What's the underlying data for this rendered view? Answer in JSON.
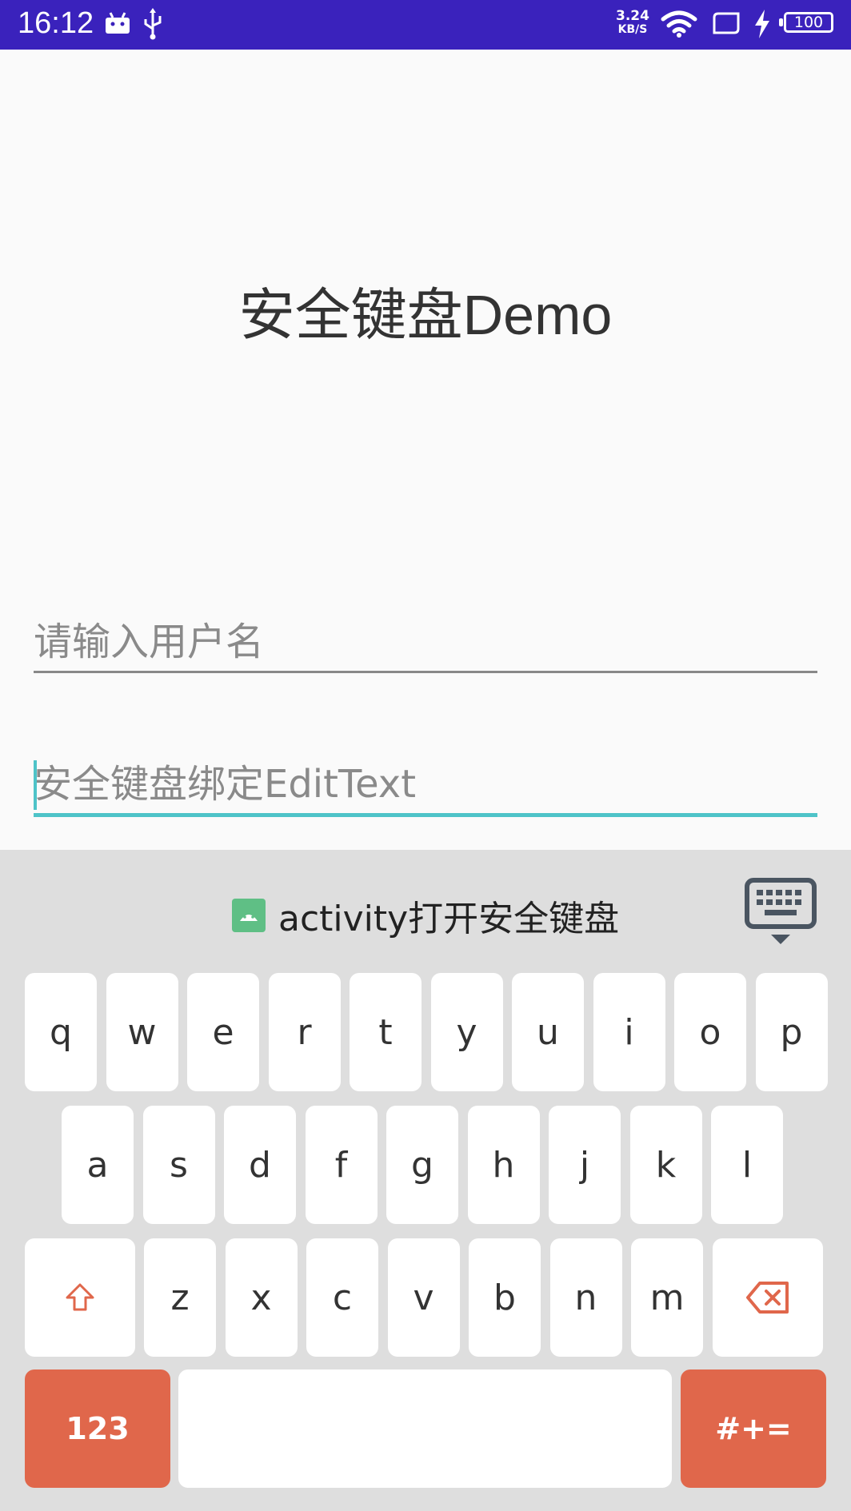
{
  "status_bar": {
    "time": "16:12",
    "net_speed_value": "3.24",
    "net_speed_unit": "KB/S",
    "battery": "100",
    "icons": [
      "android-icon",
      "usb-icon",
      "wifi-icon",
      "screen-icon",
      "charging-icon",
      "battery-icon"
    ]
  },
  "main": {
    "title": "安全键盘Demo",
    "username_placeholder": "请输入用户名",
    "secure_placeholder": "安全键盘绑定EditText"
  },
  "keyboard": {
    "title": "activity打开安全键盘",
    "row1": [
      "q",
      "w",
      "e",
      "r",
      "t",
      "y",
      "u",
      "i",
      "o",
      "p"
    ],
    "row2": [
      "a",
      "s",
      "d",
      "f",
      "g",
      "h",
      "j",
      "k",
      "l"
    ],
    "row3": [
      "z",
      "x",
      "c",
      "v",
      "b",
      "n",
      "m"
    ],
    "numbers_label": "123",
    "symbols_label": "#+=",
    "space_label": "",
    "accent_color": "#e0674b"
  }
}
